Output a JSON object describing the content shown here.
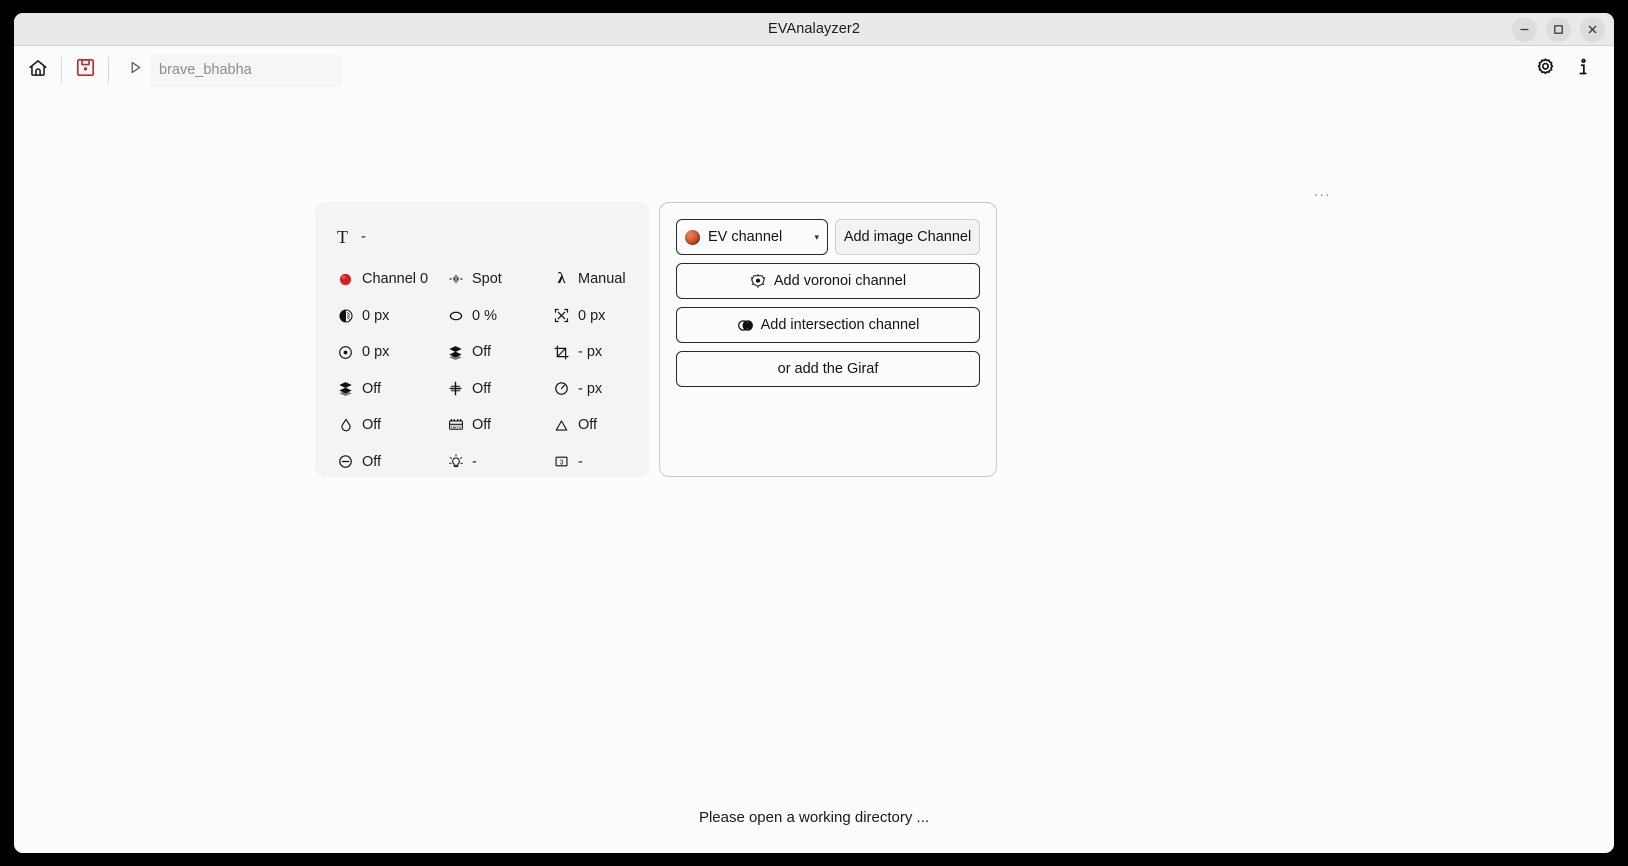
{
  "window": {
    "title": "EVAnalayzer2",
    "controls": [
      {
        "name": "minimize-button",
        "glyph": "minimize"
      },
      {
        "name": "maximize-button",
        "glyph": "maximize"
      },
      {
        "name": "close-button",
        "glyph": "close"
      }
    ]
  },
  "toolbar": {
    "home_icon": "home-icon",
    "save_icon": "save-disk-icon",
    "run_icon": "play-icon",
    "session_value": "brave_bhabha",
    "session_placeholder": "brave_bhabha",
    "settings_icon": "gear-icon",
    "info_icon": "info-icon"
  },
  "overflow_menu": {
    "label": "..."
  },
  "info_panel": {
    "title_icon": "text-T-icon",
    "title_value": "-",
    "rows": [
      [
        {
          "icon": "red-circle-icon",
          "label": "Channel 0"
        },
        {
          "icon": "spot-icon",
          "label": "Spot"
        },
        {
          "icon": "lambda-icon",
          "label": "Manual"
        }
      ],
      [
        {
          "icon": "half-filled-circle-icon",
          "label": "0 px"
        },
        {
          "icon": "ellipse-icon",
          "label": "0 %"
        },
        {
          "icon": "resize-corners-icon",
          "label": "0 px"
        }
      ],
      [
        {
          "icon": "target-dot-icon",
          "label": "0 px"
        },
        {
          "icon": "stack-layers-icon",
          "label": "Off"
        },
        {
          "icon": "crop-icon",
          "label": "- px"
        }
      ],
      [
        {
          "icon": "stack-layers-icon",
          "label": "Off"
        },
        {
          "icon": "divide-icon",
          "label": "Off"
        },
        {
          "icon": "gauge-circle-icon",
          "label": "- px"
        }
      ],
      [
        {
          "icon": "droplet-icon",
          "label": "Off"
        },
        {
          "icon": "keyboard-icon",
          "label": "Off"
        },
        {
          "icon": "triangle-icon",
          "label": "Off"
        }
      ],
      [
        {
          "icon": "minus-circle-icon",
          "label": "Off"
        },
        {
          "icon": "lightbulb-icon",
          "label": "-"
        },
        {
          "icon": "number-box-icon",
          "label": "-"
        }
      ]
    ]
  },
  "channel_panel": {
    "select": {
      "icon": "ev-sphere-icon",
      "value": "EV channel",
      "caret": "▾"
    },
    "add_image_channel": "Add image Channel",
    "add_voronoi_channel": "Add voronoi channel",
    "add_intersection_channel": "Add intersection channel",
    "add_giraf": "or add the Giraf"
  },
  "status": {
    "message": "Please open a working directory ..."
  },
  "colors": {
    "accent_red": "#d32f2f",
    "window_chrome": "#e9e9e9",
    "page_bg": "#fbfcfe",
    "card_bg": "#f4f4f4"
  }
}
